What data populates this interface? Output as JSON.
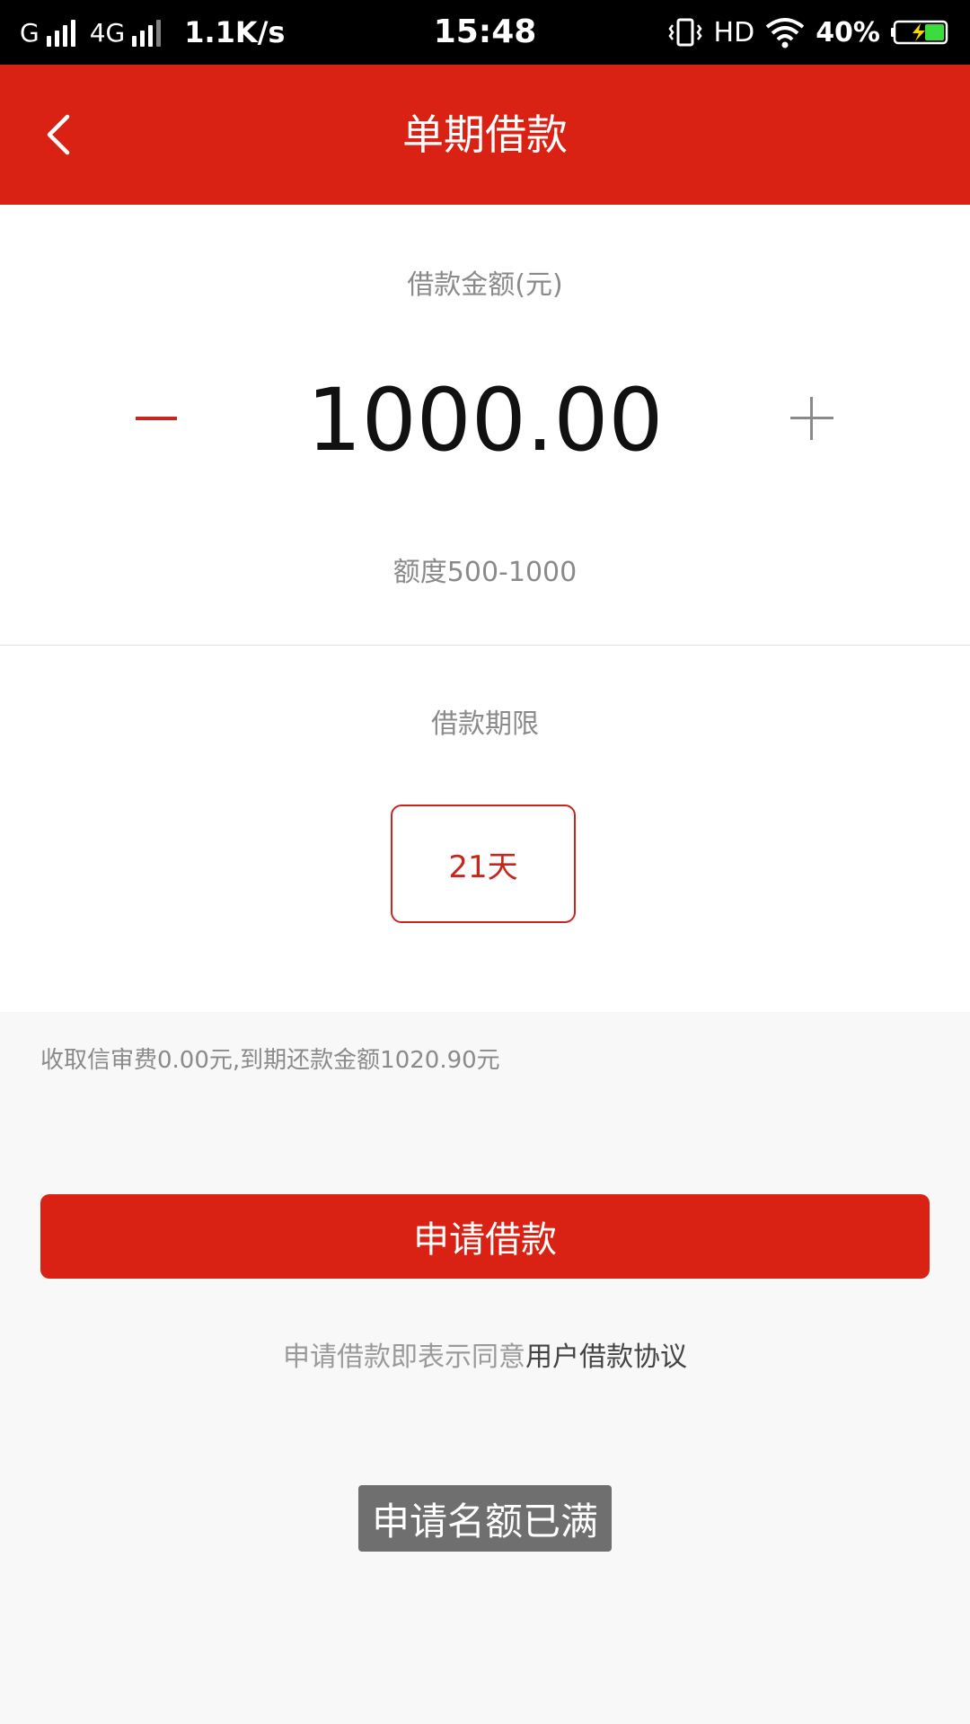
{
  "status_bar": {
    "network1": "G",
    "network2": "4G",
    "speed": "1.1K/s",
    "time": "15:48",
    "hd": "HD",
    "battery_percent": "40%",
    "icons": [
      "signal-icon",
      "vibrate-icon",
      "wifi-icon",
      "battery-charging-icon"
    ]
  },
  "header": {
    "back_icon": "chevron-left-icon",
    "title": "单期借款",
    "background_color": "#d92214"
  },
  "amount": {
    "label": "借款金额(元)",
    "value": "1000.00",
    "range": "额度500-1000",
    "minus_icon": "minus-icon",
    "plus_icon": "plus-icon"
  },
  "term": {
    "label": "借款期限",
    "option": "21天"
  },
  "fee_info": "收取信审费0.00元,到期还款金额1020.90元",
  "apply_button": {
    "label": "申请借款"
  },
  "agreement": {
    "prefix": "申请借款即表示同意",
    "link": "用户借款协议"
  },
  "toast": {
    "message": "申请名额已满"
  },
  "colors": {
    "accent": "#d92214",
    "option_border": "#c8261c",
    "muted_text": "#8a8a8a"
  }
}
